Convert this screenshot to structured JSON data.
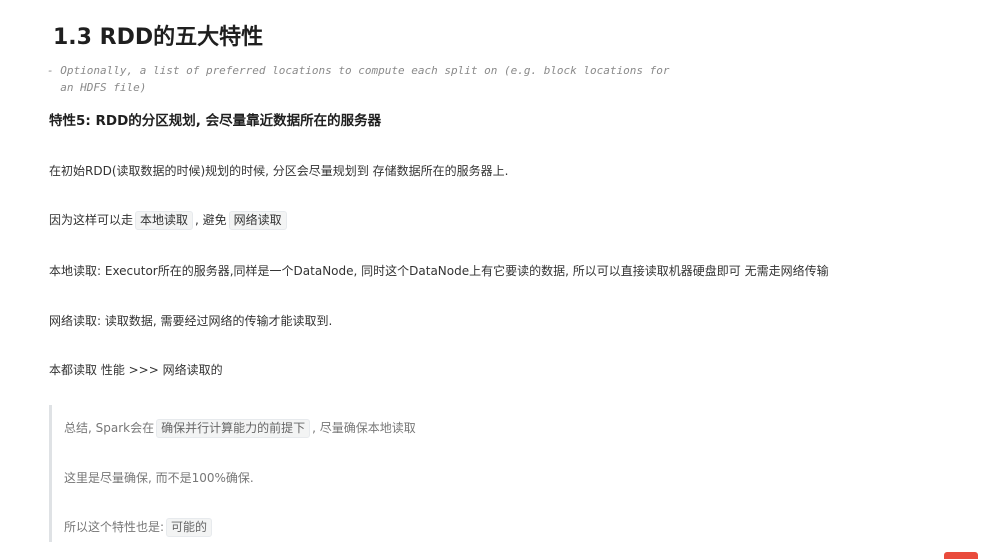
{
  "heading": "1.3 RDD的五大特性",
  "quote_code": "- Optionally, a list of preferred locations to compute each split on (e.g. block locations for\n  an HDFS file)",
  "subheading": "特性5: RDD的分区规划, 会尽量靠近数据所在的服务器",
  "para1": "在初始RDD(读取数据的时候)规划的时候, 分区会尽量规划到 存储数据所在的服务器上.",
  "para2": {
    "prefix": "因为这样可以走",
    "code1": "本地读取",
    "middle": ", 避免",
    "code2": "网络读取"
  },
  "para3": "本地读取: Executor所在的服务器,同样是一个DataNode, 同时这个DataNode上有它要读的数据, 所以可以直接读取机器硬盘即可 无需走网络传输",
  "para4": "网络读取: 读取数据, 需要经过网络的传输才能读取到.",
  "para5": "本都读取 性能 >>> 网络读取的",
  "blockquote": {
    "line1": {
      "prefix": "总结, Spark会在",
      "code": "确保并行计算能力的前提下",
      "suffix": ", 尽量确保本地读取"
    },
    "line2": "这里是尽量确保, 而不是100%确保.",
    "line3": {
      "prefix": "所以这个特性也是:",
      "code": "可能的"
    }
  },
  "colors": {
    "heading": "#1f1f1f",
    "body_text": "#333333",
    "quote_text": "#777777",
    "code_bg": "#f3f4f4",
    "quote_border": "#dfe2e5",
    "corner_mark": "#e94b3c"
  }
}
